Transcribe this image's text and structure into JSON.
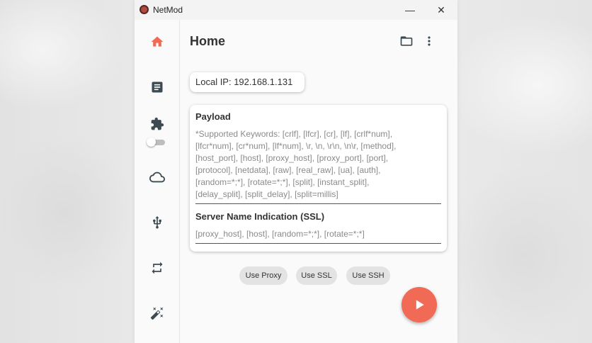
{
  "window": {
    "title": "NetMod",
    "minimize_glyph": "—",
    "close_glyph": "✕"
  },
  "sidebar": {
    "items": [
      {
        "icon": "home-icon",
        "active": true
      },
      {
        "icon": "document-icon",
        "active": false
      },
      {
        "icon": "puzzle-icon",
        "active": false
      },
      {
        "icon": "cloud-icon",
        "active": false
      },
      {
        "icon": "usb-icon",
        "active": false
      },
      {
        "icon": "repeat-icon",
        "active": false
      },
      {
        "icon": "magic-wand-icon",
        "active": false
      }
    ],
    "toggle_on": false
  },
  "header": {
    "title": "Home",
    "icons": [
      "folder-icon",
      "more-vertical-icon"
    ]
  },
  "local_ip": {
    "text": "Local IP: 192.168.1.131"
  },
  "payload": {
    "label": "Payload",
    "placeholder_lines": [
      "*Supported Keywords: [crlf], [lfcr], [cr], [lf], [crlf*num],",
      "[lfcr*num], [cr*num], [lf*num], \\r, \\n, \\r\\n, \\n\\r, [method],",
      "[host_port], [host], [proxy_host], [proxy_port], [port],",
      "[protocol], [netdata], [raw], [real_raw], [ua], [auth],",
      "[random=*;*], [rotate=*;*], [split], [instant_split],",
      "[delay_split], [split_delay], [split=millis]"
    ],
    "value": ""
  },
  "sni": {
    "label": "Server Name Indication (SSL)",
    "placeholder": "[proxy_host], [host], [random=*;*], [rotate=*;*]",
    "value": ""
  },
  "chips": [
    {
      "label": "Use Proxy"
    },
    {
      "label": "Use SSL"
    },
    {
      "label": "Use SSH"
    }
  ],
  "fab": {
    "icon": "play-icon"
  },
  "colors": {
    "accent": "#f06a55",
    "icon": "#3c4a52",
    "chip_bg": "#e3e3e3"
  }
}
